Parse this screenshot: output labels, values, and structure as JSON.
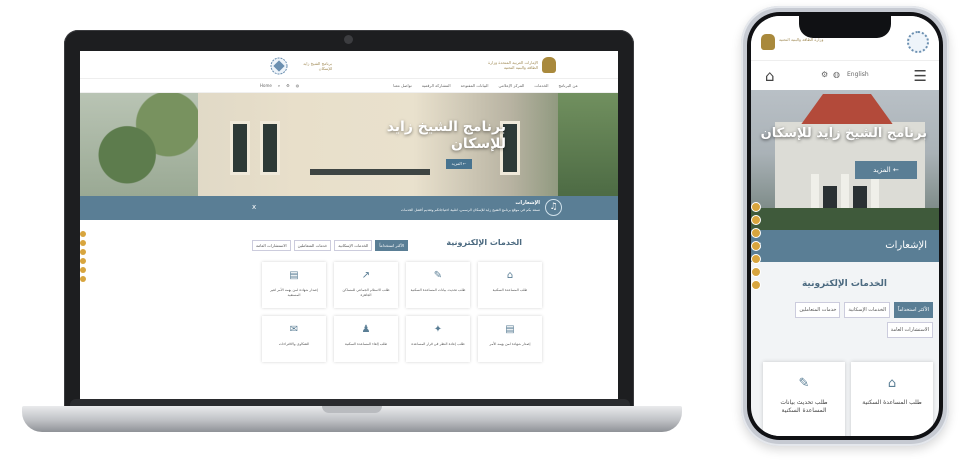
{
  "laptop": {
    "header": {
      "org_right": "الإمارات العربية المتحدة وزارة الطاقة والبنية التحتية",
      "org_left": "برنامج الشيخ زايد للإسكان"
    },
    "nav": {
      "items": [
        "عن البرنامج",
        "الخدمات",
        "المركز الإعلامي",
        "البيانات المفتوحة",
        "المشاركة الرقمية",
        "تواصل معنا"
      ],
      "home": "Home"
    },
    "hero": {
      "title": "برنامج الشيخ زايد للإسكان",
      "more": "المزيد ←"
    },
    "notifications": {
      "title": "الإشعارات",
      "message": "نسعد بكم في موقع برنامج الشيخ زايد للإسكان الرسمي، لتلبية احتياجاتكم وتقديم أفضل الخدمات",
      "close": "x"
    },
    "eservices": {
      "title": "الخدمات الإلكترونية",
      "tabs": [
        "الأكثر استخداماً",
        "الخدمات الإسكانية",
        "خدمات المتعاملين",
        "الاستشارات العامة"
      ],
      "cards": [
        {
          "icon": "home-icon",
          "glyph": "⌂",
          "label": "طلب المساعدة السكنية"
        },
        {
          "icon": "edit-icon",
          "glyph": "✎",
          "label": "طلب تحديث بيانات المساعدة السكنية"
        },
        {
          "icon": "share-icon",
          "glyph": "↗",
          "label": "طلب الاستلام الجماعي للمساكن الجاهزة"
        },
        {
          "icon": "document-icon",
          "glyph": "▤",
          "label": "إصدار شهادة لمن يهمه الأمر لغير المستفيد"
        },
        {
          "icon": "document-icon",
          "glyph": "▤",
          "label": "إصدار شهادة لمن يهمه الأمر"
        },
        {
          "icon": "handshake-icon",
          "glyph": "✦",
          "label": "طلب إعادة النظر في قرار المساعدة"
        },
        {
          "icon": "user-icon",
          "glyph": "♟",
          "label": "طلب إلغاء المساعدة السكنية"
        },
        {
          "icon": "inbox-icon",
          "glyph": "✉",
          "label": "الشكاوى والاقتراحات"
        }
      ]
    }
  },
  "phone": {
    "header": {
      "org": "وزارة الطاقة والبنية التحتية"
    },
    "bar": {
      "language": "English"
    },
    "hero": {
      "title": "برنامج الشيخ زايد للإسكان",
      "more": "المزيد ←"
    },
    "notifications": {
      "title": "الإشعارات"
    },
    "eservices": {
      "title": "الخدمات الإلكترونية",
      "tabs": [
        "الأكثر استخداماً",
        "الخدمات الإسكانية",
        "خدمات المتعاملين",
        "الاستشارات العامة"
      ],
      "cards": [
        {
          "icon": "home-icon",
          "glyph": "⌂",
          "label": "طلب المساعدة السكنية"
        },
        {
          "icon": "edit-icon",
          "glyph": "✎",
          "label": "طلب تحديث بيانات المساعدة السكنية"
        }
      ]
    }
  },
  "colors": {
    "accent": "#5a7e95",
    "gold": "#a9893c",
    "side": "#d8a53e"
  }
}
